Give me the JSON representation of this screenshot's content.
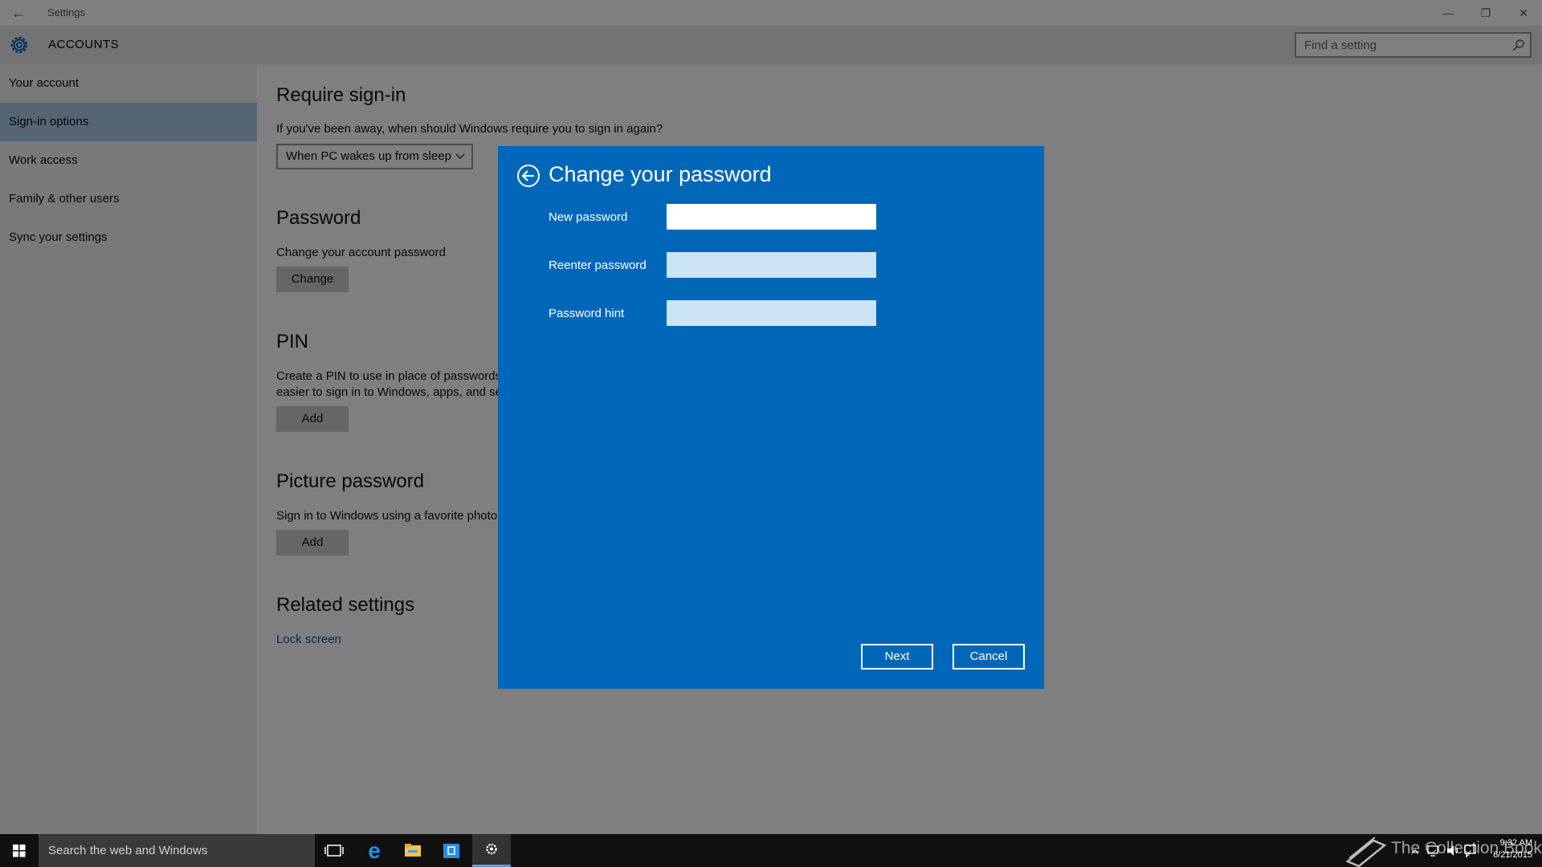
{
  "window": {
    "title": "Settings",
    "controls": {
      "minimize": "—",
      "restore": "❐",
      "close": "✕"
    }
  },
  "header": {
    "title": "ACCOUNTS",
    "search_placeholder": "Find a setting"
  },
  "sidebar": {
    "items": [
      {
        "label": "Your account"
      },
      {
        "label": "Sign-in options",
        "active": true
      },
      {
        "label": "Work access"
      },
      {
        "label": "Family & other users"
      },
      {
        "label": "Sync your settings"
      }
    ]
  },
  "main": {
    "require_signin": {
      "title": "Require sign-in",
      "description": "If you've been away, when should Windows require you to sign in again?",
      "selected": "When PC wakes up from sleep"
    },
    "password": {
      "title": "Password",
      "description": "Change your account password",
      "button": "Change"
    },
    "pin": {
      "title": "PIN",
      "description_line1": "Create a PIN to use in place of passwords.",
      "description_line2": "easier to sign in to Windows, apps, and se",
      "button": "Add"
    },
    "picture_password": {
      "title": "Picture password",
      "description": "Sign in to Windows using a favorite photo",
      "button": "Add"
    },
    "related": {
      "title": "Related settings",
      "link": "Lock screen"
    }
  },
  "dialog": {
    "title": "Change your password",
    "fields": [
      {
        "label": "New password",
        "value": ""
      },
      {
        "label": "Reenter password",
        "value": ""
      },
      {
        "label": "Password hint",
        "value": ""
      }
    ],
    "next": "Next",
    "cancel": "Cancel"
  },
  "taskbar": {
    "search_text": "Search the web and Windows",
    "watermark": "The Collection Book",
    "time": "9:32 AM",
    "date": "6/21/2015"
  },
  "colors": {
    "accent": "#0067b8",
    "active_nav": "#a8cbe8",
    "link": "#005ca9"
  }
}
